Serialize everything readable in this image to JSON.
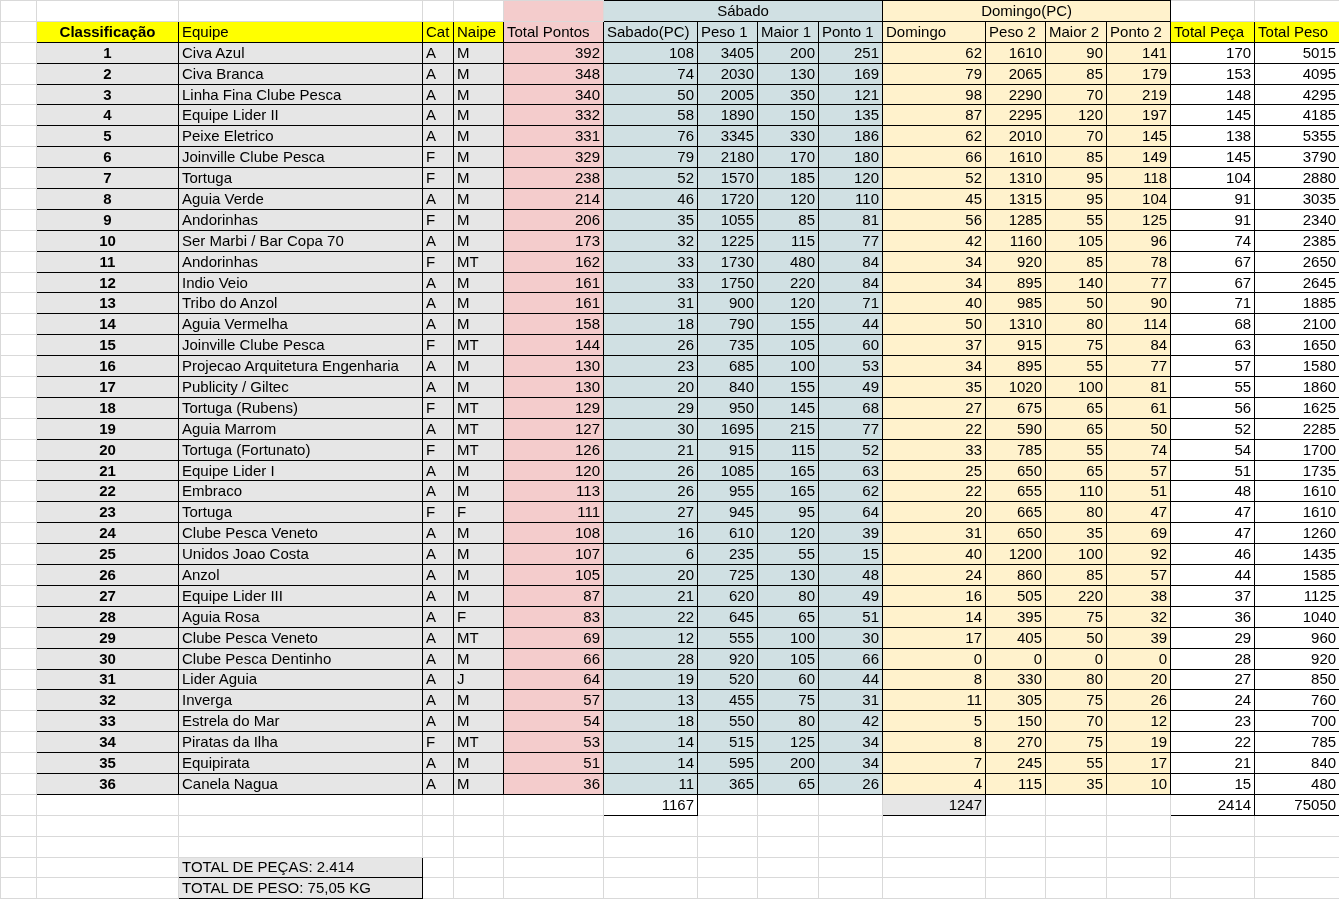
{
  "groups": {
    "sabado": "Sábado",
    "domingo": "Domingo(PC)"
  },
  "columns": [
    "Classificação",
    "Equipe",
    "Cat",
    "Naipe",
    "Total Pontos",
    "Sabado(PC)",
    "Peso 1",
    "Maior 1",
    "Ponto 1",
    "Domingo",
    "Peso 2",
    "Maior 2",
    "Ponto 2",
    "Total Peça",
    "Total Peso"
  ],
  "rows": [
    [
      "1",
      "Civa Azul",
      "A",
      "M",
      "392",
      "108",
      "3405",
      "200",
      "251",
      "62",
      "1610",
      "90",
      "141",
      "170",
      "5015"
    ],
    [
      "2",
      "Civa Branca",
      "A",
      "M",
      "348",
      "74",
      "2030",
      "130",
      "169",
      "79",
      "2065",
      "85",
      "179",
      "153",
      "4095"
    ],
    [
      "3",
      "Linha Fina Clube Pesca",
      "A",
      "M",
      "340",
      "50",
      "2005",
      "350",
      "121",
      "98",
      "2290",
      "70",
      "219",
      "148",
      "4295"
    ],
    [
      "4",
      "Equipe Lider II",
      "A",
      "M",
      "332",
      "58",
      "1890",
      "150",
      "135",
      "87",
      "2295",
      "120",
      "197",
      "145",
      "4185"
    ],
    [
      "5",
      "Peixe Eletrico",
      "A",
      "M",
      "331",
      "76",
      "3345",
      "330",
      "186",
      "62",
      "2010",
      "70",
      "145",
      "138",
      "5355"
    ],
    [
      "6",
      "Joinville Clube Pesca",
      "F",
      "M",
      "329",
      "79",
      "2180",
      "170",
      "180",
      "66",
      "1610",
      "85",
      "149",
      "145",
      "3790"
    ],
    [
      "7",
      "Tortuga",
      "F",
      "M",
      "238",
      "52",
      "1570",
      "185",
      "120",
      "52",
      "1310",
      "95",
      "118",
      "104",
      "2880"
    ],
    [
      "8",
      "Aguia Verde",
      "A",
      "M",
      "214",
      "46",
      "1720",
      "120",
      "110",
      "45",
      "1315",
      "95",
      "104",
      "91",
      "3035"
    ],
    [
      "9",
      "Andorinhas",
      "F",
      "M",
      "206",
      "35",
      "1055",
      "85",
      "81",
      "56",
      "1285",
      "55",
      "125",
      "91",
      "2340"
    ],
    [
      "10",
      "Ser Marbi / Bar Copa 70",
      "A",
      "M",
      "173",
      "32",
      "1225",
      "115",
      "77",
      "42",
      "1160",
      "105",
      "96",
      "74",
      "2385"
    ],
    [
      "11",
      "Andorinhas",
      "F",
      "MT",
      "162",
      "33",
      "1730",
      "480",
      "84",
      "34",
      "920",
      "85",
      "78",
      "67",
      "2650"
    ],
    [
      "12",
      "Indio Veio",
      "A",
      "M",
      "161",
      "33",
      "1750",
      "220",
      "84",
      "34",
      "895",
      "140",
      "77",
      "67",
      "2645"
    ],
    [
      "13",
      "Tribo do Anzol",
      "A",
      "M",
      "161",
      "31",
      "900",
      "120",
      "71",
      "40",
      "985",
      "50",
      "90",
      "71",
      "1885"
    ],
    [
      "14",
      "Aguia Vermelha",
      "A",
      "M",
      "158",
      "18",
      "790",
      "155",
      "44",
      "50",
      "1310",
      "80",
      "114",
      "68",
      "2100"
    ],
    [
      "15",
      "Joinville Clube Pesca",
      "F",
      "MT",
      "144",
      "26",
      "735",
      "105",
      "60",
      "37",
      "915",
      "75",
      "84",
      "63",
      "1650"
    ],
    [
      "16",
      "Projecao Arquitetura Engenharia",
      "A",
      "M",
      "130",
      "23",
      "685",
      "100",
      "53",
      "34",
      "895",
      "55",
      "77",
      "57",
      "1580"
    ],
    [
      "17",
      "Publicity / Giltec",
      "A",
      "M",
      "130",
      "20",
      "840",
      "155",
      "49",
      "35",
      "1020",
      "100",
      "81",
      "55",
      "1860"
    ],
    [
      "18",
      "Tortuga (Rubens)",
      "F",
      "MT",
      "129",
      "29",
      "950",
      "145",
      "68",
      "27",
      "675",
      "65",
      "61",
      "56",
      "1625"
    ],
    [
      "19",
      "Aguia Marrom",
      "A",
      "MT",
      "127",
      "30",
      "1695",
      "215",
      "77",
      "22",
      "590",
      "65",
      "50",
      "52",
      "2285"
    ],
    [
      "20",
      "Tortuga (Fortunato)",
      "F",
      "MT",
      "126",
      "21",
      "915",
      "115",
      "52",
      "33",
      "785",
      "55",
      "74",
      "54",
      "1700"
    ],
    [
      "21",
      "Equipe Lider I",
      "A",
      "M",
      "120",
      "26",
      "1085",
      "165",
      "63",
      "25",
      "650",
      "65",
      "57",
      "51",
      "1735"
    ],
    [
      "22",
      "Embraco",
      "A",
      "M",
      "113",
      "26",
      "955",
      "165",
      "62",
      "22",
      "655",
      "110",
      "51",
      "48",
      "1610"
    ],
    [
      "23",
      "Tortuga",
      "F",
      "F",
      "111",
      "27",
      "945",
      "95",
      "64",
      "20",
      "665",
      "80",
      "47",
      "47",
      "1610"
    ],
    [
      "24",
      "Clube Pesca Veneto",
      "A",
      "M",
      "108",
      "16",
      "610",
      "120",
      "39",
      "31",
      "650",
      "35",
      "69",
      "47",
      "1260"
    ],
    [
      "25",
      "Unidos Joao Costa",
      "A",
      "M",
      "107",
      "6",
      "235",
      "55",
      "15",
      "40",
      "1200",
      "100",
      "92",
      "46",
      "1435"
    ],
    [
      "26",
      "Anzol",
      "A",
      "M",
      "105",
      "20",
      "725",
      "130",
      "48",
      "24",
      "860",
      "85",
      "57",
      "44",
      "1585"
    ],
    [
      "27",
      "Equipe Lider III",
      "A",
      "M",
      "87",
      "21",
      "620",
      "80",
      "49",
      "16",
      "505",
      "220",
      "38",
      "37",
      "1125"
    ],
    [
      "28",
      "Aguia Rosa",
      "A",
      "F",
      "83",
      "22",
      "645",
      "65",
      "51",
      "14",
      "395",
      "75",
      "32",
      "36",
      "1040"
    ],
    [
      "29",
      "Clube Pesca Veneto",
      "A",
      "MT",
      "69",
      "12",
      "555",
      "100",
      "30",
      "17",
      "405",
      "50",
      "39",
      "29",
      "960"
    ],
    [
      "30",
      "Clube Pesca Dentinho",
      "A",
      "M",
      "66",
      "28",
      "920",
      "105",
      "66",
      "0",
      "0",
      "0",
      "0",
      "28",
      "920"
    ],
    [
      "31",
      "Lider Aguia",
      "A",
      "J",
      "64",
      "19",
      "520",
      "60",
      "44",
      "8",
      "330",
      "80",
      "20",
      "27",
      "850"
    ],
    [
      "32",
      "Inverga",
      "A",
      "M",
      "57",
      "13",
      "455",
      "75",
      "31",
      "11",
      "305",
      "75",
      "26",
      "24",
      "760"
    ],
    [
      "33",
      "Estrela do Mar",
      "A",
      "M",
      "54",
      "18",
      "550",
      "80",
      "42",
      "5",
      "150",
      "70",
      "12",
      "23",
      "700"
    ],
    [
      "34",
      "Piratas da Ilha",
      "F",
      "MT",
      "53",
      "14",
      "515",
      "125",
      "34",
      "8",
      "270",
      "75",
      "19",
      "22",
      "785"
    ],
    [
      "35",
      "Equipirata",
      "A",
      "M",
      "51",
      "14",
      "595",
      "200",
      "34",
      "7",
      "245",
      "55",
      "17",
      "21",
      "840"
    ],
    [
      "36",
      "Canela Nagua",
      "A",
      "M",
      "36",
      "11",
      "365",
      "65",
      "26",
      "4",
      "115",
      "35",
      "10",
      "15",
      "480"
    ]
  ],
  "totals": {
    "sabado": "1167",
    "domingo": "1247",
    "total_peca": "2414",
    "total_peso": "75050"
  },
  "summary": [
    "TOTAL DE PEÇAS: 2.414",
    "TOTAL DE PESO: 75,05 KG"
  ]
}
